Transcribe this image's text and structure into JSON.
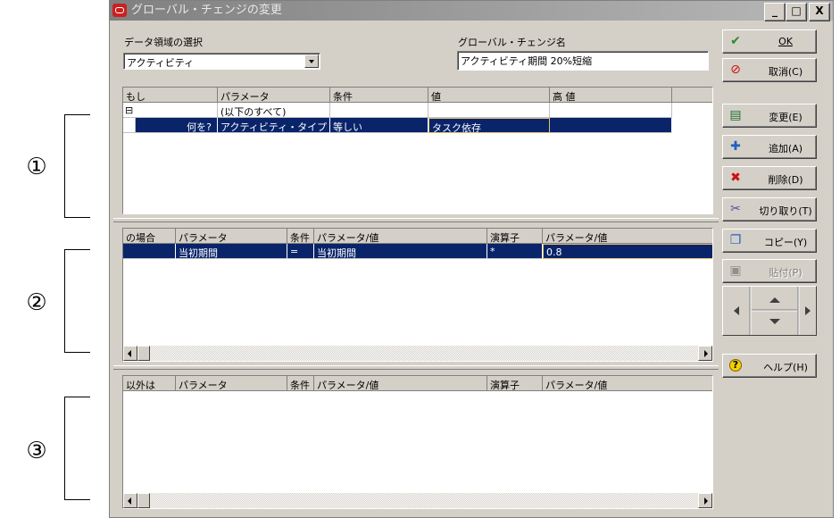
{
  "window": {
    "title": "グローバル・チェンジの変更"
  },
  "titlebar_buttons": [
    "_",
    "□",
    "X"
  ],
  "filters": {
    "data_area_label": "データ領域の選択",
    "data_area_value": "アクティビティ",
    "global_change_name_label": "グローバル・チェンジ名",
    "global_change_name_value": "アクティビティ期間 20%短縮"
  },
  "if_grid": {
    "headers": [
      "もし",
      "パラメータ",
      "条件",
      "値",
      "高 値"
    ],
    "rows": [
      {
        "col1": "⊟",
        "parameter": "(以下のすべて)",
        "condition": "",
        "value": "",
        "high": ""
      },
      {
        "col1": "何を?",
        "parameter": "アクティビティ・タイプ",
        "condition": "等しい",
        "value": "タスク依存",
        "high": ""
      }
    ]
  },
  "then_grid": {
    "headers": [
      "の場合",
      "パラメータ",
      "条件",
      "パラメータ/値",
      "演算子",
      "パラメータ/値"
    ],
    "rows": [
      {
        "col1": "",
        "parameter": "当初期間",
        "condition": "=",
        "param_value": "当初期間",
        "operator": "*",
        "param_value2": "0.8"
      }
    ]
  },
  "else_grid": {
    "headers": [
      "以外は",
      "パラメータ",
      "条件",
      "パラメータ/値",
      "演算子",
      "パラメータ/値"
    ],
    "rows": []
  },
  "callouts": [
    "①",
    "②",
    "③"
  ],
  "buttons": {
    "ok": "OK",
    "cancel": "取消(C)",
    "change": "変更(E)",
    "add": "追加(A)",
    "delete": "削除(D)",
    "cut": "切り取り(T)",
    "copy": "コピー(Y)",
    "paste": "貼付(P)",
    "help": "ヘルプ(H)"
  },
  "icons": {
    "ok": "check-icon",
    "cancel": "no-entry-icon",
    "change": "edit-row-icon",
    "add": "plus-icon",
    "delete": "red-x-icon",
    "cut": "scissors-icon",
    "copy": "copy-icon",
    "paste": "paste-icon",
    "help": "help-icon"
  },
  "colors": {
    "selection": "#0a246a",
    "title_logo": "#cc1f1f",
    "dialog_bg": "#d4d0c8"
  }
}
